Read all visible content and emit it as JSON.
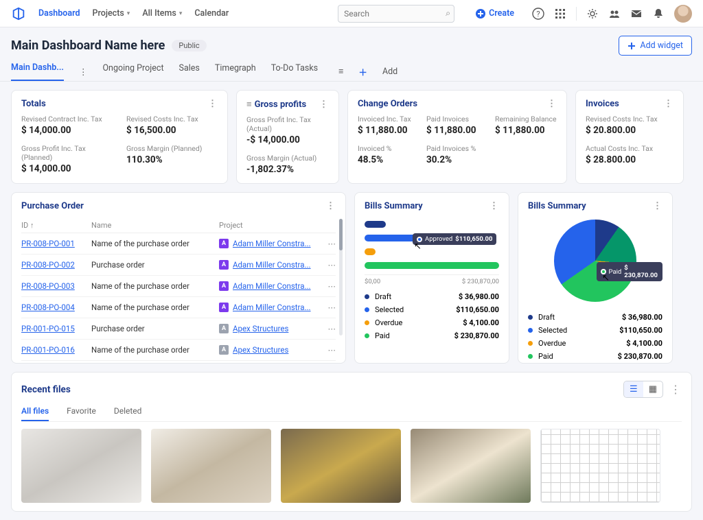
{
  "topnav": {
    "dashboard": "Dashboard",
    "projects": "Projects",
    "all_items": "All Items",
    "calendar": "Calendar",
    "search_placeholder": "Search",
    "create": "Create"
  },
  "header": {
    "title": "Main Dashboard Name here",
    "badge": "Public",
    "add_widget": "Add widget"
  },
  "tabs": {
    "main": "Main Dashb...",
    "ongoing": "Ongoing Project",
    "sales": "Sales",
    "timegraph": "Timegraph",
    "todo": "To-Do Tasks",
    "add": "Add"
  },
  "totals": {
    "title": "Totals",
    "revised_contract_label": "Revised Contract Inc. Tax",
    "revised_contract_value": "$ 14,000.00",
    "revised_costs_label": "Revised Costs Inc. Tax",
    "revised_costs_value": "$ 16,500.00",
    "gp_planned_label": "Gross Profit Inc. Tax (Planned)",
    "gp_planned_value": "$ 14,000.00",
    "gm_planned_label": "Gross Margin (Planned)",
    "gm_planned_value": "110.30%"
  },
  "gross": {
    "title": "Gross profits",
    "gp_actual_label": "Gross Profit Inc. Tax (Actual)",
    "gp_actual_value": "-$ 14,000.00",
    "gm_actual_label": "Gross Margin (Actual)",
    "gm_actual_value": "-1,802.37%"
  },
  "change_orders": {
    "title": "Change Orders",
    "invoiced_label": "Invoiced Inc. Tax",
    "invoiced_value": "$ 11,880.00",
    "paid_inv_label": "Paid Invoices",
    "paid_inv_value": "$ 11,880.00",
    "remaining_label": "Remaining Balance",
    "remaining_value": "$ 11,880.00",
    "invoiced_pct_label": "Invoiced %",
    "invoiced_pct_value": "48.5%",
    "paid_pct_label": "Paid Invoices %",
    "paid_pct_value": "30.2%"
  },
  "invoices": {
    "title": "Invoices",
    "revised_costs_label": "Revised Costs Inc. Tax",
    "revised_costs_value": "$ 20.800.00",
    "actual_costs_label": "Actual Costs Inc. Tax",
    "actual_costs_value": "$ 28.800.00"
  },
  "po": {
    "title": "Purchase Order",
    "cols": {
      "id": "ID",
      "name": "Name",
      "project": "Project"
    },
    "rows": [
      {
        "id": "PR-008-PO-001",
        "name": "Name of the purchase order",
        "project": "Adam Miller Constra...",
        "badge": "A",
        "color": "p"
      },
      {
        "id": "PR-008-PO-002",
        "name": "Purchase order",
        "project": "Adam Miller Constra...",
        "badge": "A",
        "color": "p"
      },
      {
        "id": "PR-008-PO-003",
        "name": "Name of the purchase order",
        "project": "Adam Miller Constra...",
        "badge": "A",
        "color": "p"
      },
      {
        "id": "PR-008-PO-004",
        "name": "Name of the purchase order",
        "project": "Adam Miller Constra...",
        "badge": "A",
        "color": "p"
      },
      {
        "id": "PR-001-PO-015",
        "name": "Purchase order",
        "project": "Apex Structures",
        "badge": "A",
        "color": "g"
      },
      {
        "id": "PR-001-PO-016",
        "name": "Name of the purchase order",
        "project": "Apex Structures",
        "badge": "A",
        "color": "g"
      }
    ]
  },
  "bills_bar": {
    "title": "Bills Summary",
    "tooltip_label": "Approved",
    "tooltip_value": "$110,650.00",
    "axis_min": "$0,00",
    "axis_max": "$ 230,870,00"
  },
  "bills_pie": {
    "title": "Bills Summary",
    "tooltip_label": "Paid",
    "tooltip_value": "$ 230,870.00"
  },
  "legend": [
    {
      "label": "Draft",
      "value": "$ 36,980.00",
      "color": "#1e3a8a"
    },
    {
      "label": "Selected",
      "value": "$110,650.00",
      "color": "#2563eb"
    },
    {
      "label": "Overdue",
      "value": "$ 4,100.00",
      "color": "#f59e0b"
    },
    {
      "label": "Paid",
      "value": "$ 230,870.00",
      "color": "#22c55e"
    }
  ],
  "chart_data": {
    "bar": {
      "type": "bar",
      "orientation": "horizontal",
      "categories": [
        "Draft",
        "Selected",
        "Overdue",
        "Paid"
      ],
      "values": [
        36980,
        110650,
        4100,
        230870
      ],
      "colors": [
        "#1e3a8a",
        "#2563eb",
        "#f59e0b",
        "#22c55e"
      ],
      "xlim": [
        0,
        230870
      ],
      "xlabel": "",
      "ylabel": "",
      "title": "Bills Summary",
      "highlighted": {
        "label": "Approved",
        "value": 110650
      }
    },
    "pie": {
      "type": "pie",
      "title": "Bills Summary",
      "series": [
        {
          "name": "Draft",
          "value": 36980,
          "color": "#1e3a8a"
        },
        {
          "name": "Selected",
          "value": 110650,
          "color": "#2563eb"
        },
        {
          "name": "Overdue",
          "value": 4100,
          "color": "#f59e0b"
        },
        {
          "name": "Paid",
          "value": 230870,
          "color": "#22c55e"
        }
      ],
      "highlighted": {
        "label": "Paid",
        "value": 230870
      }
    }
  },
  "files": {
    "title": "Recent files",
    "tabs": {
      "all": "All files",
      "fav": "Favorite",
      "del": "Deleted"
    }
  }
}
